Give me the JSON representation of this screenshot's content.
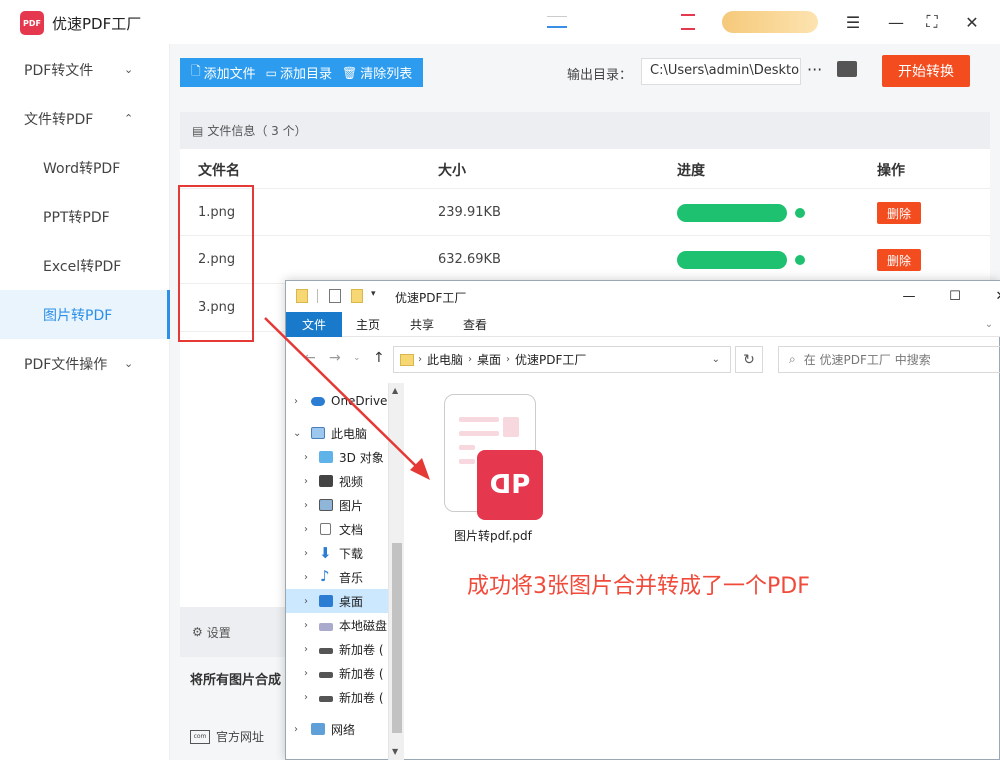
{
  "app": {
    "title": "优速PDF工厂",
    "logo_text": "PDF"
  },
  "sidebar": {
    "items": [
      {
        "label": "PDF转文件",
        "chevron": "⌄"
      },
      {
        "label": "文件转PDF",
        "chevron": "⌃"
      },
      {
        "label": "Word转PDF"
      },
      {
        "label": "PPT转PDF"
      },
      {
        "label": "Excel转PDF"
      },
      {
        "label": "图片转PDF"
      },
      {
        "label": "PDF文件操作",
        "chevron": "⌄"
      }
    ]
  },
  "toolbar": {
    "add_file": "添加文件",
    "add_dir": "添加目录",
    "clear_list": "清除列表",
    "output_label": "输出目录：",
    "output_path": "C:\\Users\\admin\\Desktop",
    "more": "···",
    "start": "开始转换"
  },
  "file_panel": {
    "header": "文件信息（ 3 个）",
    "columns": {
      "name": "文件名",
      "size": "大小",
      "progress": "进度",
      "action": "操作"
    },
    "rows": [
      {
        "name": "1.png",
        "size": "239.91KB",
        "progress": 1.0,
        "action": "删除"
      },
      {
        "name": "2.png",
        "size": "632.69KB",
        "progress": 1.0,
        "action": "删除"
      },
      {
        "name": "3.png"
      }
    ]
  },
  "settings": {
    "label": "设置",
    "merge_text": "将所有图片合成"
  },
  "footer": {
    "website": "官方网址",
    "website_icon_text": "com"
  },
  "explorer": {
    "title": "优速PDF工厂",
    "ribbon": [
      "文件",
      "主页",
      "共享",
      "查看"
    ],
    "address": [
      "此电脑",
      "桌面",
      "优速PDF工厂"
    ],
    "search_placeholder": "在 优速PDF工厂 中搜索",
    "tree": [
      {
        "label": "OneDrive",
        "icon": "cloud-icon"
      },
      {
        "label": "此电脑",
        "icon": "computer-icon"
      },
      {
        "label": "3D 对象",
        "icon": "cube-icon"
      },
      {
        "label": "视频",
        "icon": "video-icon"
      },
      {
        "label": "图片",
        "icon": "picture-icon"
      },
      {
        "label": "文档",
        "icon": "document-icon"
      },
      {
        "label": "下载",
        "icon": "download-icon"
      },
      {
        "label": "音乐",
        "icon": "music-icon"
      },
      {
        "label": "桌面",
        "icon": "desktop-icon"
      },
      {
        "label": "本地磁盘",
        "icon": "disk-icon"
      },
      {
        "label": "新加卷 (",
        "icon": "drive-icon"
      },
      {
        "label": "新加卷 (",
        "icon": "drive-icon"
      },
      {
        "label": "新加卷 (",
        "icon": "drive-icon"
      },
      {
        "label": "网络",
        "icon": "network-icon"
      }
    ],
    "file": {
      "name": "图片转pdf.pdf",
      "badge": "ᗡP"
    }
  },
  "annotation": {
    "text": "成功将3张图片合并转成了一个PDF",
    "color": "#f04a3a"
  },
  "colors": {
    "accent": "#2d9cee",
    "start": "#f24c1f",
    "progress": "#1ec16f",
    "pdf_red": "#e5374d"
  }
}
